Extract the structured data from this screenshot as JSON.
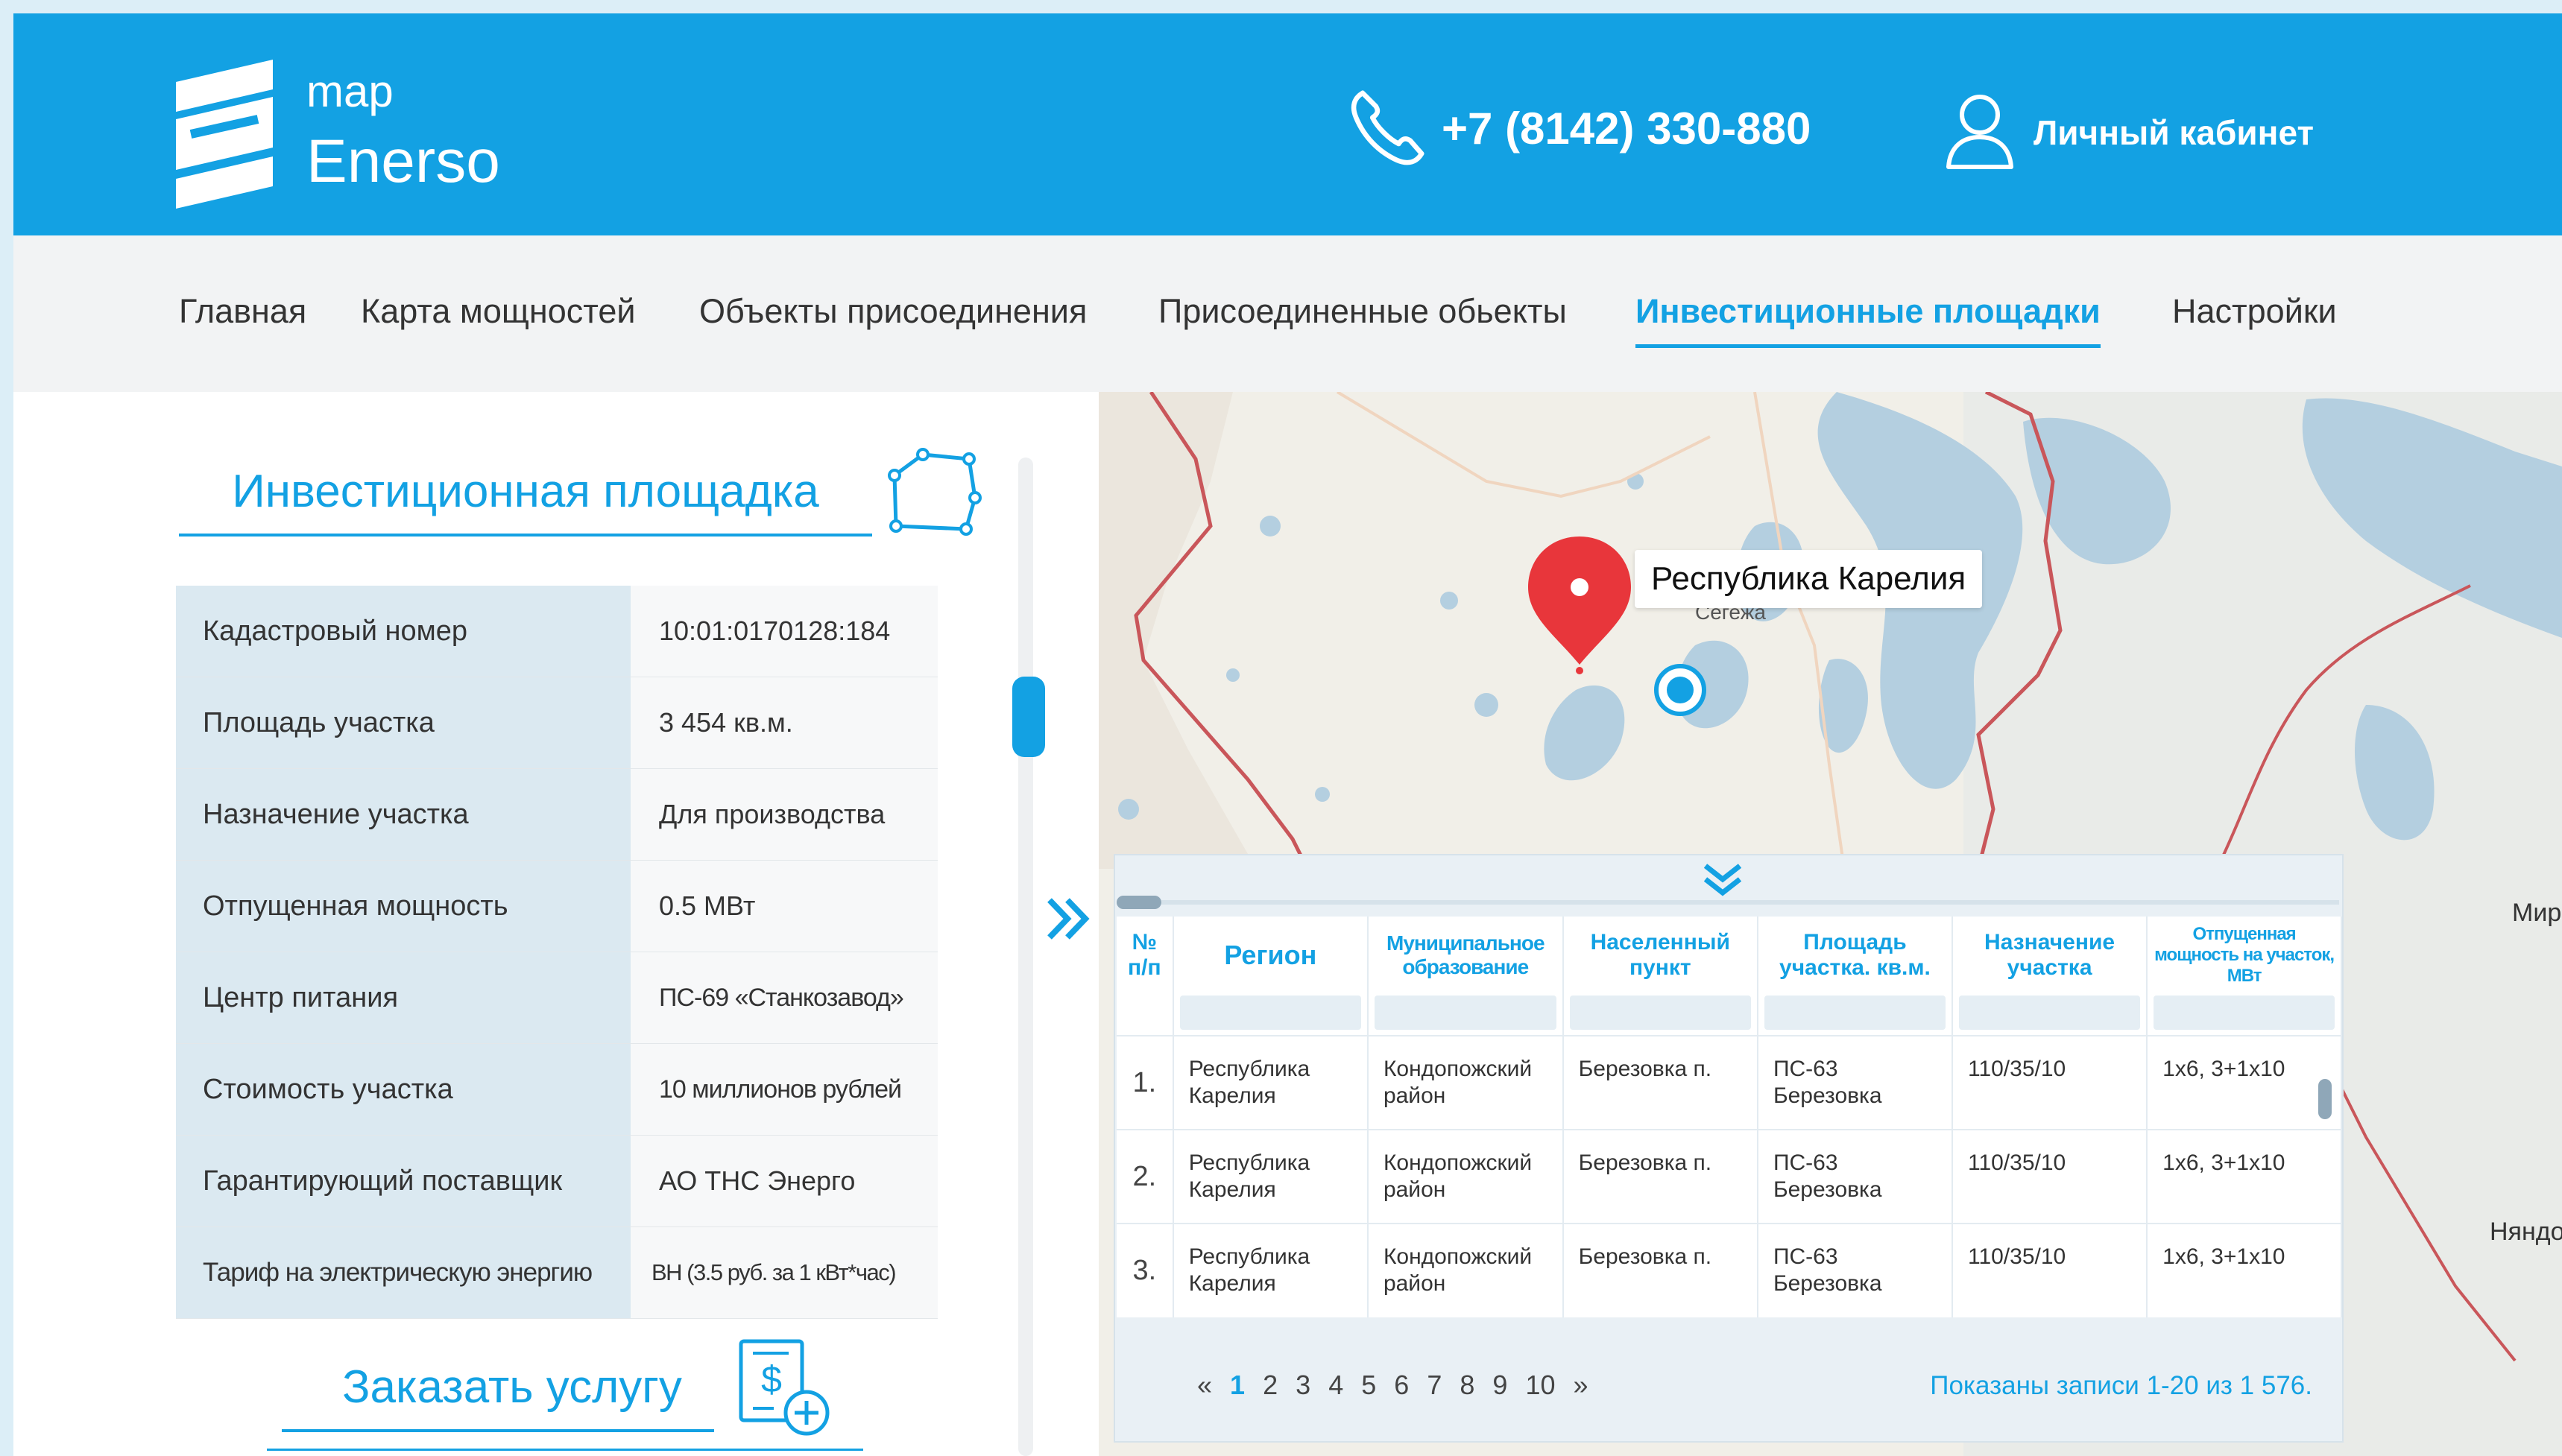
{
  "header": {
    "logo_top": "map",
    "logo_name": "Enerso",
    "phone": "+7 (8142) 330-880",
    "account_label": "Личный кабинет"
  },
  "nav": {
    "items": [
      "Главная",
      "Карта мощностей",
      "Объекты присоединения",
      "Присоединенные обьекты",
      "Инвестиционные площадки",
      "Настройки"
    ],
    "active": "Инвестиционные площадки"
  },
  "site": {
    "title": "Инвестиционная площадка",
    "rows": [
      {
        "key": "Кадастровый номер",
        "value": "10:01:0170128:184"
      },
      {
        "key": "Площадь участка",
        "value": "3 454 кв.м."
      },
      {
        "key": "Назначение участка",
        "value": "Для производства"
      },
      {
        "key": "Отпущенная мощность",
        "value": "0.5 МВт"
      },
      {
        "key": "Центр питания",
        "value": "ПС-69 «Станкозавод»"
      },
      {
        "key": "Стоимость участка",
        "value": "10 миллионов рублей"
      },
      {
        "key": "Гарантирующий поставщик",
        "value": "АО ТНС Энерго"
      },
      {
        "key": "Тариф на электрическую энергию",
        "value": "ВН (3.5 руб. за 1 кВт*час)"
      }
    ],
    "order_label": "Заказать услугу"
  },
  "map": {
    "region_label": "Республика Карелия",
    "city_segezha": "Сегежа",
    "city_mirny": "Мирн",
    "city_nyandoma": "Няндом"
  },
  "table": {
    "headers": [
      "№ п/п",
      "Регион",
      "Муниципальное образование",
      "Населенный пункт",
      "Площадь участка. кв.м.",
      "Назначение участка",
      "Отпущенная мощность на участок, МВт"
    ],
    "rows": [
      [
        "1.",
        "Республика Карелия",
        "Кондопожский район",
        "Березовка п.",
        "ПС-63 Березовка",
        "110/35/10",
        "1х6, 3+1х10"
      ],
      [
        "2.",
        "Республика Карелия",
        "Кондопожский район",
        "Березовка п.",
        "ПС-63 Березовка",
        "110/35/10",
        "1х6, 3+1х10"
      ],
      [
        "3.",
        "Республика Карелия",
        "Кондопожский район",
        "Березовка п.",
        "ПС-63 Березовка",
        "110/35/10",
        "1х6, 3+1х10"
      ]
    ],
    "pager": {
      "prev": "«",
      "pages": [
        "1",
        "2",
        "3",
        "4",
        "5",
        "6",
        "7",
        "8",
        "9",
        "10"
      ],
      "current": "1",
      "next": "»"
    },
    "records_text": "Показаны записи 1-20 из 1 576."
  },
  "colors": {
    "brand": "#13a1e3",
    "marker": "#e8363b",
    "border": "#c9565a"
  },
  "icons": [
    "logo-mark",
    "phone-icon",
    "user-icon",
    "polygon-icon",
    "dollar-add-icon",
    "expand-icon",
    "collapse-icon",
    "location-pin-icon",
    "current-location-icon"
  ]
}
